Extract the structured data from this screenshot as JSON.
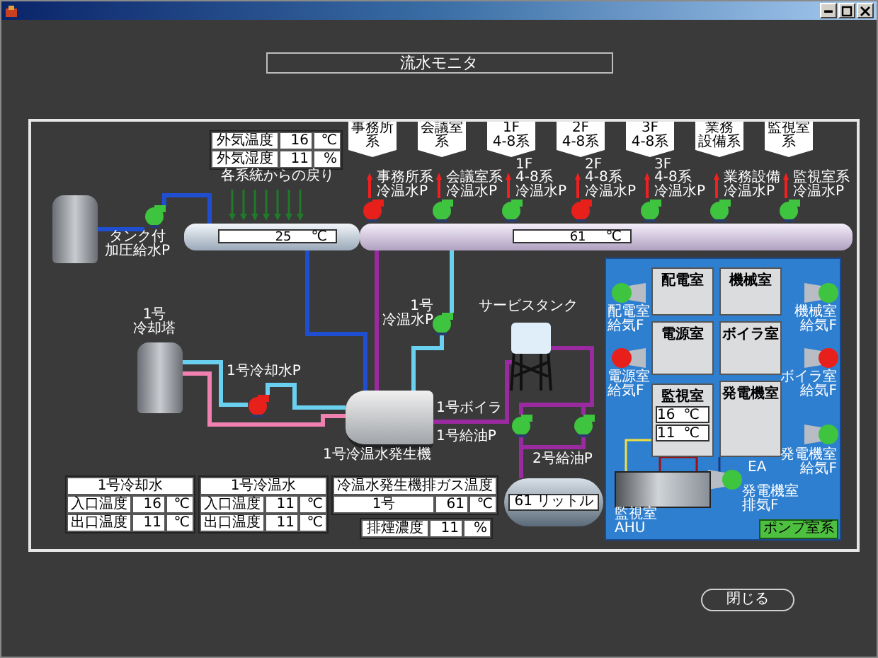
{
  "title": "流水モニタ",
  "outdoor": [
    {
      "label": "外気温度",
      "value": "16",
      "unit": "℃"
    },
    {
      "label": "外気湿度",
      "value": "11",
      "unit": "%"
    }
  ],
  "return_label": "各系統からの戻り",
  "supply_pump": {
    "label": [
      "タンク付",
      "加圧給水P"
    ],
    "color": "#3ec43e"
  },
  "cold_header": {
    "value": "25",
    "unit": "℃"
  },
  "hot_header": {
    "value": "61",
    "unit": "℃"
  },
  "zone_pumps": [
    {
      "sign": [
        "事務所",
        "系"
      ],
      "label": [
        "事務所系",
        "冷温水P"
      ],
      "color": "#e8201c"
    },
    {
      "sign": [
        "会議室",
        "系"
      ],
      "label": [
        "会議室系",
        "冷温水P"
      ],
      "color": "#3ec43e"
    },
    {
      "sign": [
        "1F",
        "4-8系"
      ],
      "label": [
        "1F",
        "4-8系",
        "冷温水P"
      ],
      "color": "#3ec43e"
    },
    {
      "sign": [
        "2F",
        "4-8系"
      ],
      "label": [
        "2F",
        "4-8系",
        "冷温水P"
      ],
      "color": "#e8201c"
    },
    {
      "sign": [
        "3F",
        "4-8系"
      ],
      "label": [
        "3F",
        "4-8系",
        "冷温水P"
      ],
      "color": "#3ec43e"
    },
    {
      "sign": [
        "業務",
        "設備系"
      ],
      "label": [
        "業務設備",
        "冷温水P"
      ],
      "color": "#3ec43e"
    },
    {
      "sign": [
        "監視室",
        "系"
      ],
      "label": [
        "監視室系",
        "冷温水P"
      ],
      "color": "#3ec43e"
    }
  ],
  "cooling_tower": {
    "label": [
      "1号",
      "冷却塔"
    ]
  },
  "cooling_pump": {
    "label": "1号冷却水P",
    "color": "#e8201c"
  },
  "chiller": {
    "label": "1号冷温水発生機"
  },
  "chilled_pump": {
    "label": [
      "1号",
      "冷温水P"
    ],
    "color": "#3ec43e"
  },
  "boiler_label": "1号ボイラ",
  "service_tank": {
    "label": "サービスタンク"
  },
  "oil_pumps": [
    {
      "label": "1号給油P",
      "color": "#3ec43e"
    },
    {
      "label": "2号給油P",
      "color": "#3ec43e"
    }
  ],
  "oil_tank": {
    "value": "61",
    "unit": "リットル"
  },
  "tables": [
    {
      "title": "1号冷却水",
      "rows": [
        {
          "label": "入口温度",
          "value": "16",
          "unit": "℃"
        },
        {
          "label": "出口温度",
          "value": "11",
          "unit": "℃"
        }
      ]
    },
    {
      "title": "1号冷温水",
      "rows": [
        {
          "label": "入口温度",
          "value": "11",
          "unit": "℃"
        },
        {
          "label": "出口温度",
          "value": "11",
          "unit": "℃"
        }
      ]
    },
    {
      "title": "冷温水発生機排ガス温度",
      "rows": [
        {
          "label": "1号",
          "value": "61",
          "unit": "℃"
        }
      ]
    }
  ],
  "smoke": {
    "label": "排煙濃度",
    "value": "11",
    "unit": "%"
  },
  "pump_room": {
    "label": "ポンプ室系",
    "ahu_label": [
      "監視室",
      "AHU"
    ],
    "exhaust_label": "EA",
    "rooms": [
      {
        "name": "配電室"
      },
      {
        "name": "機械室"
      },
      {
        "name": "電源室"
      },
      {
        "name": "ボイラ室"
      },
      {
        "name": "監視室",
        "readings": [
          {
            "value": "16",
            "unit": "℃"
          },
          {
            "value": "11",
            "unit": "℃"
          }
        ]
      },
      {
        "name": "発電機室"
      }
    ],
    "fans": [
      {
        "label": [
          "配電室",
          "給気F"
        ],
        "color": "#3ec43e"
      },
      {
        "label": [
          "機械室",
          "給気F"
        ],
        "color": "#3ec43e"
      },
      {
        "label": [
          "電源室",
          "給気F"
        ],
        "color": "#e8201c"
      },
      {
        "label": [
          "ボイラ室",
          "給気F"
        ],
        "color": "#e8201c"
      },
      {
        "label": [
          "発電機室",
          "給気F"
        ],
        "color": "#3ec43e"
      },
      {
        "label": [
          "発電機室",
          "排気F"
        ],
        "color": "#3ec43e"
      }
    ]
  },
  "close_button": "閉じる"
}
